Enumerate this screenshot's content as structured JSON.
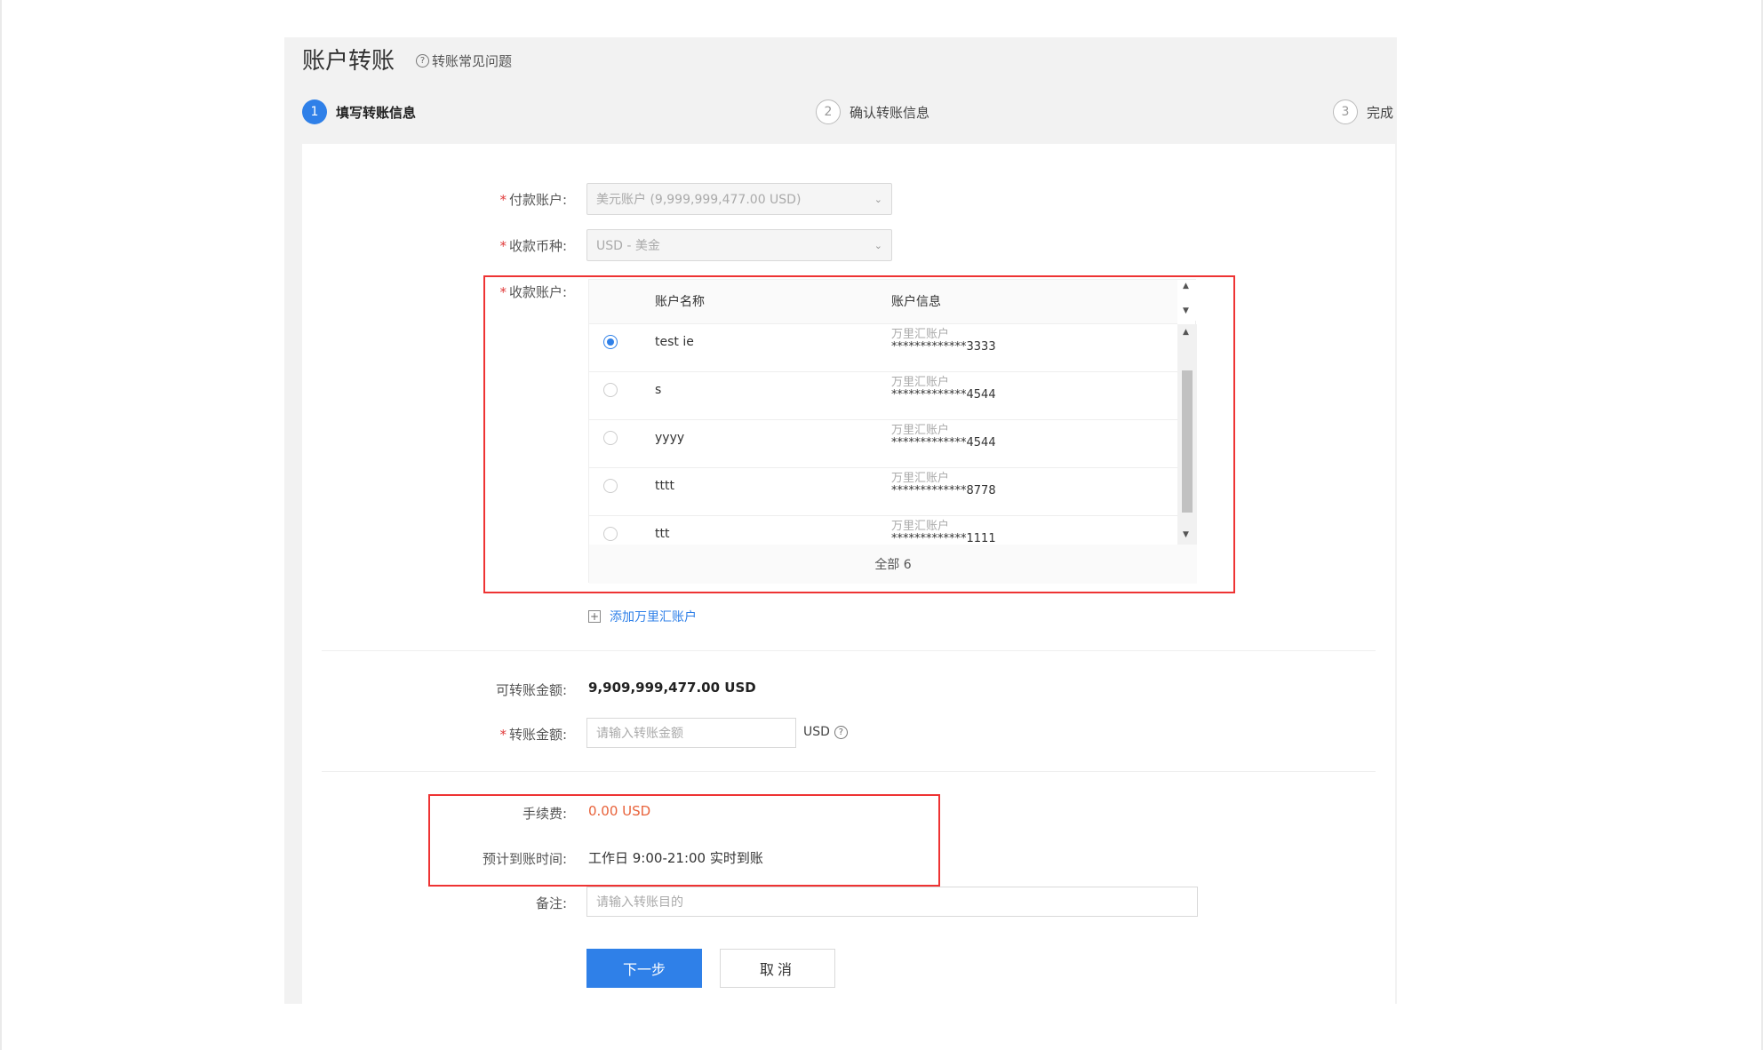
{
  "header": {
    "title": "账户转账",
    "faq_label": "转账常见问题"
  },
  "steps": [
    {
      "num": "1",
      "label": "填写转账信息"
    },
    {
      "num": "2",
      "label": "确认转账信息"
    },
    {
      "num": "3",
      "label": "完成"
    }
  ],
  "form": {
    "payer_label": "付款账户:",
    "payer_value": "美元账户 (9,999,999,477.00 USD)",
    "currency_label": "收款币种:",
    "currency_value": "USD - 美金",
    "payee_label": "收款账户:",
    "table": {
      "col_name": "账户名称",
      "col_info": "账户信息",
      "rows": [
        {
          "name": "test ie",
          "type": "万里汇账户",
          "number": "*************3333"
        },
        {
          "name": "s",
          "type": "万里汇账户",
          "number": "*************4544"
        },
        {
          "name": "yyyy",
          "type": "万里汇账户",
          "number": "*************4544"
        },
        {
          "name": "tttt",
          "type": "万里汇账户",
          "number": "*************8778"
        },
        {
          "name": "ttt",
          "type": "万里汇账户",
          "number": "*************1111"
        }
      ],
      "footer": "全部 6"
    },
    "add_account": "添加万里汇账户",
    "available_label": "可转账金额:",
    "available_value": "9,909,999,477.00 USD",
    "amount_label": "转账金额:",
    "amount_placeholder": "请输入转账金额",
    "amount_unit": "USD",
    "fee_label": "手续费:",
    "fee_value": "0.00 USD",
    "eta_label": "预计到账时间:",
    "eta_value": "工作日 9:00-21:00 实时到账",
    "remark_label": "备注:",
    "remark_placeholder": "请输入转账目的",
    "next_button": "下一步",
    "cancel_button": "取消"
  },
  "colors": {
    "primary": "#2f80e8",
    "fee": "#e8623a",
    "required": "#e03a3a",
    "highlight_box": "#e33333"
  }
}
